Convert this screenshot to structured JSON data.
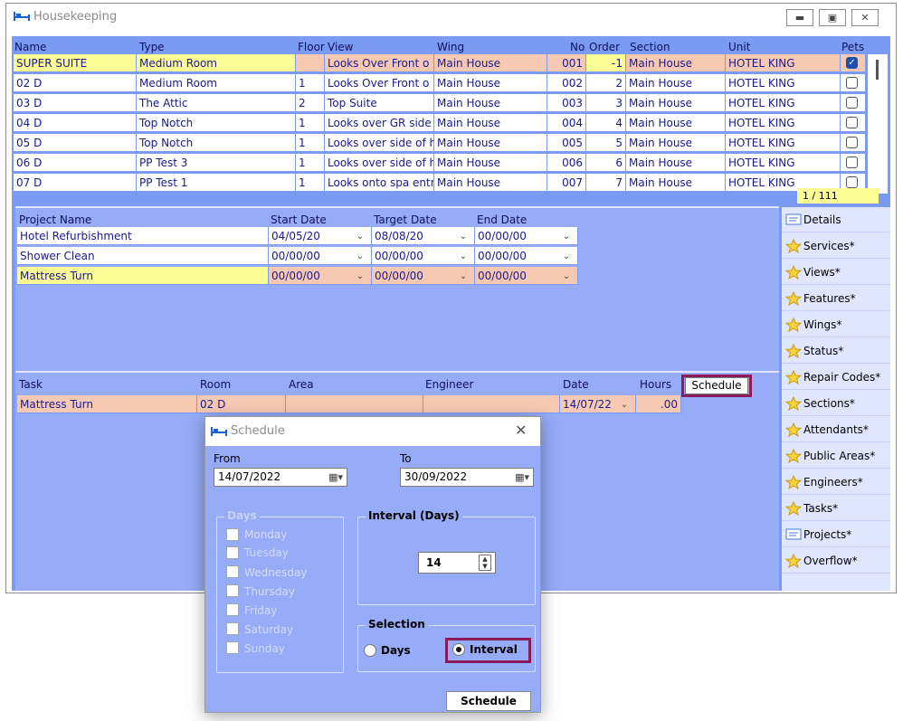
{
  "window": {
    "title": "Housekeeping",
    "icon": "bed-icon"
  },
  "rooms": {
    "headers": [
      "Name",
      "Type",
      "Floor",
      "View",
      "Wing",
      "No",
      "Order",
      "Section",
      "Unit",
      "Pets"
    ],
    "rows": [
      {
        "name": "SUPER SUITE",
        "type": "Medium Room",
        "floor": "",
        "view": "Looks Over Front o",
        "wing": "Main House",
        "no": "001",
        "order": "-1",
        "section": "Main House",
        "unit": "HOTEL KING",
        "pets": true
      },
      {
        "name": "02 D",
        "type": "Medium Room",
        "floor": "1",
        "view": "Looks Over Front o",
        "wing": "Main House",
        "no": "002",
        "order": "2",
        "section": "Main House",
        "unit": "HOTEL KING",
        "pets": false
      },
      {
        "name": "03 D",
        "type": "The Attic",
        "floor": "2",
        "view": "Top Suite",
        "wing": "Main House",
        "no": "003",
        "order": "3",
        "section": "Main House",
        "unit": "HOTEL KING",
        "pets": false
      },
      {
        "name": "04 D",
        "type": "Top Notch",
        "floor": "1",
        "view": "Looks over GR side",
        "wing": "Main House",
        "no": "004",
        "order": "4",
        "section": "Main House",
        "unit": "HOTEL KING",
        "pets": false
      },
      {
        "name": "05 D",
        "type": "Top Notch",
        "floor": "1",
        "view": "Looks over side of h",
        "wing": "Main House",
        "no": "005",
        "order": "5",
        "section": "Main House",
        "unit": "HOTEL KING",
        "pets": false
      },
      {
        "name": "06 D",
        "type": "PP Test 3",
        "floor": "1",
        "view": "Looks over side of h",
        "wing": "Main House",
        "no": "006",
        "order": "6",
        "section": "Main House",
        "unit": "HOTEL KING",
        "pets": false
      },
      {
        "name": "07 D",
        "type": "PP Test 1",
        "floor": "1",
        "view": "Looks onto spa entr",
        "wing": "Main House",
        "no": "007",
        "order": "7",
        "section": "Main House",
        "unit": "HOTEL KING",
        "pets": false
      }
    ],
    "record_counter": "1 / 111"
  },
  "projects": {
    "headers": [
      "Project Name",
      "Start Date",
      "Target Date",
      "End Date"
    ],
    "rows": [
      {
        "name": "Hotel Refurbishment",
        "start": "04/05/20",
        "target": "08/08/20",
        "end": "00/00/00"
      },
      {
        "name": "Shower Clean",
        "start": "00/00/00",
        "target": "00/00/00",
        "end": "00/00/00"
      },
      {
        "name": "Mattress Turn",
        "start": "00/00/00",
        "target": "00/00/00",
        "end": "00/00/00"
      }
    ]
  },
  "tasks": {
    "headers": [
      "Task",
      "Room",
      "Area",
      "Engineer",
      "Date",
      "Hours"
    ],
    "schedule_button": "Schedule",
    "rows": [
      {
        "task": "Mattress Turn",
        "room": "02 D",
        "area": "",
        "engineer": "",
        "date": "14/07/22",
        "hours": ".00"
      }
    ]
  },
  "sidebar": {
    "items": [
      {
        "label": "Details",
        "icon": "note-icon"
      },
      {
        "label": "Services*",
        "icon": "star-icon"
      },
      {
        "label": "Views*",
        "icon": "star-icon"
      },
      {
        "label": "Features*",
        "icon": "star-icon"
      },
      {
        "label": "Wings*",
        "icon": "star-icon"
      },
      {
        "label": "Status*",
        "icon": "star-icon"
      },
      {
        "label": "Repair Codes*",
        "icon": "star-icon"
      },
      {
        "label": "Sections*",
        "icon": "star-icon"
      },
      {
        "label": "Attendants*",
        "icon": "star-icon"
      },
      {
        "label": "Public Areas*",
        "icon": "star-icon"
      },
      {
        "label": "Engineers*",
        "icon": "star-icon"
      },
      {
        "label": "Tasks*",
        "icon": "star-icon"
      },
      {
        "label": "Projects*",
        "icon": "note-icon"
      },
      {
        "label": "Overflow*",
        "icon": "star-icon"
      }
    ]
  },
  "dialog": {
    "title": "Schedule",
    "from_label": "From",
    "from_value": "14/07/2022",
    "to_label": "To",
    "to_value": "30/09/2022",
    "days_group_label": "Days",
    "days": [
      "Monday",
      "Tuesday",
      "Wednesday",
      "Thursday",
      "Friday",
      "Saturday",
      "Sunday"
    ],
    "interval_group_label": "Interval (Days)",
    "interval_value": "14",
    "selection_group_label": "Selection",
    "selection_options": [
      "Days",
      "Interval"
    ],
    "selected_option": "Interval",
    "schedule_button": "Schedule"
  },
  "colors": {
    "grid_blue": "#7b9bf2",
    "panel_blue": "#96acf8",
    "selected_yellow": "#fdfd95",
    "selected_peach": "#f7c9b2",
    "highlight": "#8a1a5a"
  }
}
